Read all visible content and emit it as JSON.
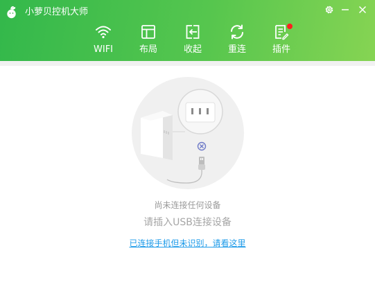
{
  "app": {
    "title": "小萝贝控机大师"
  },
  "window_controls": [
    {
      "name": "settings",
      "icon": "gear-icon"
    },
    {
      "name": "minimize",
      "icon": "minimize-icon"
    },
    {
      "name": "close",
      "icon": "close-icon"
    }
  ],
  "toolbar": {
    "items": [
      {
        "label": "WIFI",
        "icon": "wifi-icon"
      },
      {
        "label": "布局",
        "icon": "layout-icon"
      },
      {
        "label": "收起",
        "icon": "collapse-icon"
      },
      {
        "label": "重连",
        "icon": "reconnect-icon"
      },
      {
        "label": "插件",
        "icon": "plugin-icon",
        "has_notification_dot": true
      }
    ]
  },
  "status": {
    "main": "尚未连接任何设备",
    "sub": "请插入USB连接设备",
    "help_link": "已连接手机但未识别，请看这里"
  },
  "colors": {
    "header_start": "#33b84b",
    "header_end": "#86d453",
    "link": "#1e9be9",
    "notification_dot": "#ff1f1f",
    "muted_text": "#9a9a9a"
  }
}
